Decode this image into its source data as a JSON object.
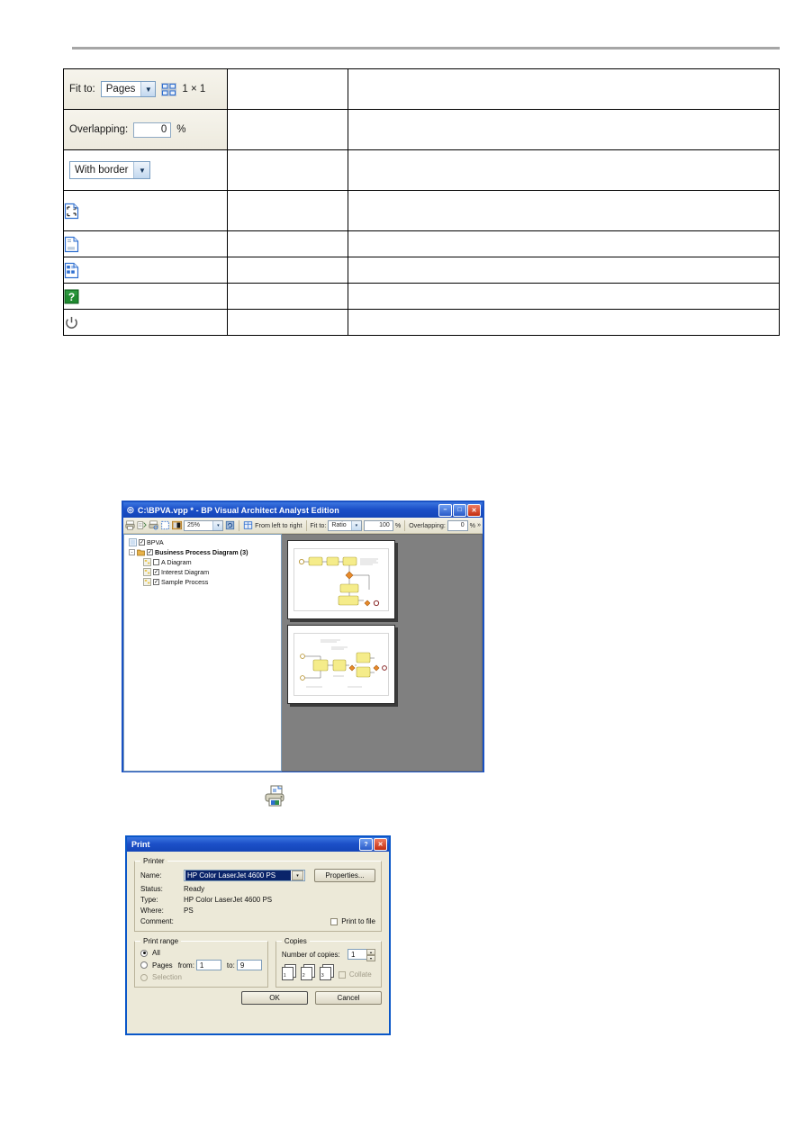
{
  "reference_table": {
    "rows": [
      {
        "id": "fit-to",
        "type": "control-fit",
        "label": "Fit to:",
        "combo_value": "Pages",
        "grid_icon": "pages-grid-icon",
        "pages_value": "1 × 1",
        "col2": "",
        "col3": ""
      },
      {
        "id": "overlapping",
        "type": "control-overlap",
        "label": "Overlapping:",
        "value": "0",
        "unit": "%",
        "col2": "",
        "col3": ""
      },
      {
        "id": "with-border",
        "type": "control-border",
        "combo_value": "With border",
        "col2": "",
        "col3": ""
      },
      {
        "id": "fit-window",
        "type": "icon",
        "icon": "fit-to-window-page-icon",
        "col2": "",
        "col3": ""
      },
      {
        "id": "single-page",
        "type": "icon",
        "icon": "single-page-icon",
        "col2": "",
        "col3": ""
      },
      {
        "id": "multi-page",
        "type": "icon",
        "icon": "multi-page-grid-icon",
        "col2": "",
        "col3": ""
      },
      {
        "id": "help",
        "type": "icon",
        "icon": "green-question-help-icon",
        "col2": "",
        "col3": ""
      },
      {
        "id": "exit",
        "type": "icon",
        "icon": "power-exit-icon",
        "col2": "",
        "col3": ""
      }
    ]
  },
  "app_window": {
    "title": "C:\\BPVA.vpp * - BP Visual Architect Analyst Edition",
    "window_buttons": {
      "minimize": "–",
      "maximize": "□",
      "close": "✕"
    },
    "toolbar": {
      "icons": [
        "print-icon",
        "print-setup-icon",
        "print-preview-icon",
        "page-setup-icon",
        "color-mode-icon"
      ],
      "zoom_value": "25%",
      "zoom_arrow": "▾",
      "refresh_icon": "refresh-icon",
      "order_icon": "page-order-icon",
      "order_label": "From left to right",
      "fit_to_label": "Fit to:",
      "fit_to_value": "Ratio",
      "fit_to_arrow": "▾",
      "ratio_value": "100",
      "ratio_unit": "%",
      "overlapping_label": "Overlapping:",
      "overlapping_value": "0",
      "overlapping_unit": "%",
      "overflow": "»"
    },
    "tree": [
      {
        "label": "BPVA",
        "checked": true,
        "bold": false,
        "depth": 0,
        "icon": "project-icon",
        "twisty": ""
      },
      {
        "label": "Business Process Diagram (3)",
        "checked": true,
        "bold": true,
        "depth": 0,
        "icon": "folder-icon",
        "twisty": "-"
      },
      {
        "label": "A Diagram",
        "checked": false,
        "bold": false,
        "depth": 1,
        "icon": "diagram-icon",
        "twisty": ""
      },
      {
        "label": "Interest Diagram",
        "checked": true,
        "bold": false,
        "depth": 1,
        "icon": "diagram-icon",
        "twisty": ""
      },
      {
        "label": "Sample Process",
        "checked": true,
        "bold": false,
        "depth": 1,
        "icon": "diagram-icon",
        "twisty": ""
      }
    ],
    "preview_pages": [
      {
        "name": "preview-page-1",
        "diagram": "bpmn-vertical-flow"
      },
      {
        "name": "preview-page-2",
        "diagram": "bpmn-horizontal-flow"
      }
    ]
  },
  "printer_icon": {
    "name": "printer-icon"
  },
  "print_dialog": {
    "title": "Print",
    "help_button": "?",
    "close_button": "✕",
    "printer_group": {
      "legend": "Printer",
      "name_label": "Name:",
      "name_value": "HP Color LaserJet 4600 PS",
      "dropdown_arrow": "▾",
      "properties_button": "Properties...",
      "status_label": "Status:",
      "status_value": "Ready",
      "type_label": "Type:",
      "type_value": "HP Color LaserJet 4600 PS",
      "where_label": "Where:",
      "where_value": "PS",
      "comment_label": "Comment:",
      "comment_value": "",
      "print_to_file_label": "Print to file",
      "print_to_file_checked": false
    },
    "print_range": {
      "legend": "Print range",
      "all_label": "All",
      "all_selected": true,
      "pages_label": "Pages",
      "pages_selected": false,
      "from_label": "from:",
      "from_value": "1",
      "to_label": "to:",
      "to_value": "9",
      "selection_label": "Selection",
      "selection_enabled": false
    },
    "copies": {
      "legend": "Copies",
      "number_label": "Number of copies:",
      "number_value": "1",
      "spin_up": "▴",
      "spin_down": "▾",
      "collate_label": "Collate",
      "collate_enabled": false,
      "page_numbers": [
        "1",
        "2",
        "3"
      ]
    },
    "ok_button": "OK",
    "cancel_button": "Cancel"
  },
  "colors": {
    "titlebar_blue": "#1c50c8",
    "dialog_face": "#ece9d8",
    "preview_grey": "#808080",
    "selection_blue": "#0a246a",
    "help_green": "#1f8a2f"
  }
}
